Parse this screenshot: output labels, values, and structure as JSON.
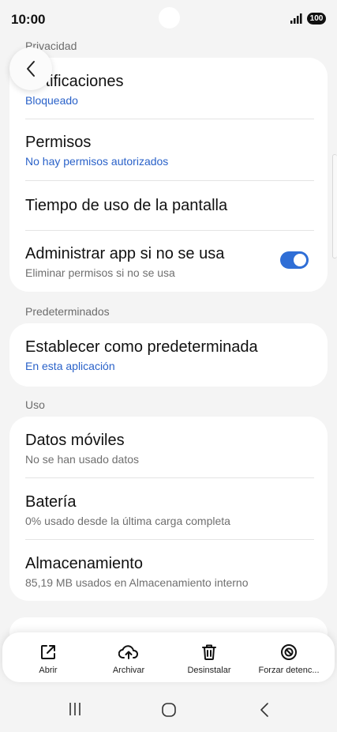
{
  "status_bar": {
    "time": "10:00",
    "battery": "100"
  },
  "sections": {
    "privacy": "Privacidad",
    "defaults": "Predeterminados",
    "usage": "Uso"
  },
  "privacy_items": [
    {
      "title": "Notificaciones",
      "subtitle": "Bloqueado"
    },
    {
      "title": "Permisos",
      "subtitle": "No hay permisos autorizados"
    },
    {
      "title": "Tiempo de uso de la pantalla"
    },
    {
      "title": "Administrar app si no se usa",
      "subtitle": "Eliminar permisos si no se usa",
      "toggle_on": true
    }
  ],
  "default_item": {
    "title": "Establecer como predeterminada",
    "subtitle": "En esta aplicación"
  },
  "usage_items": [
    {
      "title": "Datos móviles",
      "subtitle": "No se han usado datos"
    },
    {
      "title": "Batería",
      "subtitle": "0% usado desde la última carga completa"
    },
    {
      "title": "Almacenamiento",
      "subtitle": "85,19 MB usados en Almacenamiento interno"
    }
  ],
  "actions": {
    "open": "Abrir",
    "archive": "Archivar",
    "uninstall": "Desinstalar",
    "force_stop": "Forzar detenc..."
  },
  "colors": {
    "accent": "#2f6ed6",
    "link": "#2a62c9",
    "background": "#f4f4f4"
  },
  "icons": [
    "back-arrow-icon",
    "open-external-icon",
    "cloud-upload-icon",
    "trash-icon",
    "block-icon",
    "recent-apps-icon",
    "home-icon",
    "back-nav-icon"
  ]
}
